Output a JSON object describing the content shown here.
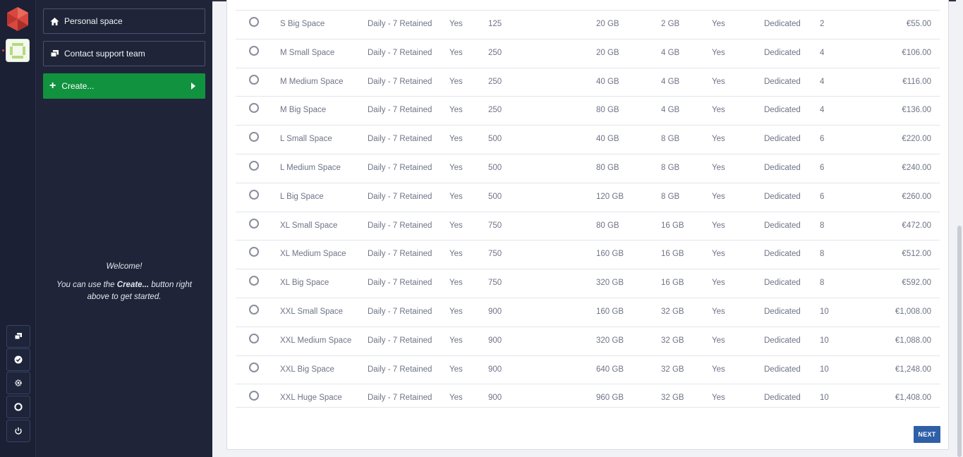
{
  "sidebar": {
    "personal_space": "Personal space",
    "contact_support": "Contact support team",
    "create": "Create...",
    "welcome_title": "Welcome!",
    "welcome_pre": "You can use the ",
    "welcome_bold": "Create...",
    "welcome_post": " button right above to get started."
  },
  "rail": {
    "icons": [
      "logo-icon",
      "space-avatar",
      "windows-icon",
      "check-circle-icon",
      "gear-icon",
      "lifebuoy-icon",
      "power-icon"
    ]
  },
  "plans": [
    {
      "name": "S Big Space",
      "backup": "Daily - 7 Retained",
      "ssl": "Yes",
      "users": "125",
      "storage": "20 GB",
      "ram": "2 GB",
      "support": "Yes",
      "type": "Dedicated",
      "cpu": "2",
      "price": "€55.00"
    },
    {
      "name": "M Small Space",
      "backup": "Daily - 7 Retained",
      "ssl": "Yes",
      "users": "250",
      "storage": "20 GB",
      "ram": "4 GB",
      "support": "Yes",
      "type": "Dedicated",
      "cpu": "4",
      "price": "€106.00"
    },
    {
      "name": "M Medium Space",
      "backup": "Daily - 7 Retained",
      "ssl": "Yes",
      "users": "250",
      "storage": "40 GB",
      "ram": "4 GB",
      "support": "Yes",
      "type": "Dedicated",
      "cpu": "4",
      "price": "€116.00"
    },
    {
      "name": "M Big Space",
      "backup": "Daily - 7 Retained",
      "ssl": "Yes",
      "users": "250",
      "storage": "80 GB",
      "ram": "4 GB",
      "support": "Yes",
      "type": "Dedicated",
      "cpu": "4",
      "price": "€136.00"
    },
    {
      "name": "L Small Space",
      "backup": "Daily - 7 Retained",
      "ssl": "Yes",
      "users": "500",
      "storage": "40 GB",
      "ram": "8 GB",
      "support": "Yes",
      "type": "Dedicated",
      "cpu": "6",
      "price": "€220.00"
    },
    {
      "name": "L Medium Space",
      "backup": "Daily - 7 Retained",
      "ssl": "Yes",
      "users": "500",
      "storage": "80 GB",
      "ram": "8 GB",
      "support": "Yes",
      "type": "Dedicated",
      "cpu": "6",
      "price": "€240.00"
    },
    {
      "name": "L Big Space",
      "backup": "Daily - 7 Retained",
      "ssl": "Yes",
      "users": "500",
      "storage": "120 GB",
      "ram": "8 GB",
      "support": "Yes",
      "type": "Dedicated",
      "cpu": "6",
      "price": "€260.00"
    },
    {
      "name": "XL Small Space",
      "backup": "Daily - 7 Retained",
      "ssl": "Yes",
      "users": "750",
      "storage": "80 GB",
      "ram": "16 GB",
      "support": "Yes",
      "type": "Dedicated",
      "cpu": "8",
      "price": "€472.00"
    },
    {
      "name": "XL Medium Space",
      "backup": "Daily - 7 Retained",
      "ssl": "Yes",
      "users": "750",
      "storage": "160 GB",
      "ram": "16 GB",
      "support": "Yes",
      "type": "Dedicated",
      "cpu": "8",
      "price": "€512.00"
    },
    {
      "name": "XL Big Space",
      "backup": "Daily - 7 Retained",
      "ssl": "Yes",
      "users": "750",
      "storage": "320 GB",
      "ram": "16 GB",
      "support": "Yes",
      "type": "Dedicated",
      "cpu": "8",
      "price": "€592.00"
    },
    {
      "name": "XXL Small Space",
      "backup": "Daily - 7 Retained",
      "ssl": "Yes",
      "users": "900",
      "storage": "160 GB",
      "ram": "32 GB",
      "support": "Yes",
      "type": "Dedicated",
      "cpu": "10",
      "price": "€1,008.00"
    },
    {
      "name": "XXL Medium Space",
      "backup": "Daily - 7 Retained",
      "ssl": "Yes",
      "users": "900",
      "storage": "320 GB",
      "ram": "32 GB",
      "support": "Yes",
      "type": "Dedicated",
      "cpu": "10",
      "price": "€1,088.00"
    },
    {
      "name": "XXL Big Space",
      "backup": "Daily - 7 Retained",
      "ssl": "Yes",
      "users": "900",
      "storage": "640 GB",
      "ram": "32 GB",
      "support": "Yes",
      "type": "Dedicated",
      "cpu": "10",
      "price": "€1,248.00"
    },
    {
      "name": "XXL Huge Space",
      "backup": "Daily - 7 Retained",
      "ssl": "Yes",
      "users": "900",
      "storage": "960 GB",
      "ram": "32 GB",
      "support": "Yes",
      "type": "Dedicated",
      "cpu": "10",
      "price": "€1,408.00"
    }
  ],
  "next_label": "NEXT",
  "colors": {
    "rail_bg": "#1b2034",
    "panel_bg": "#1f2438",
    "create_green": "#11923f",
    "next_blue": "#2f5fa7"
  }
}
